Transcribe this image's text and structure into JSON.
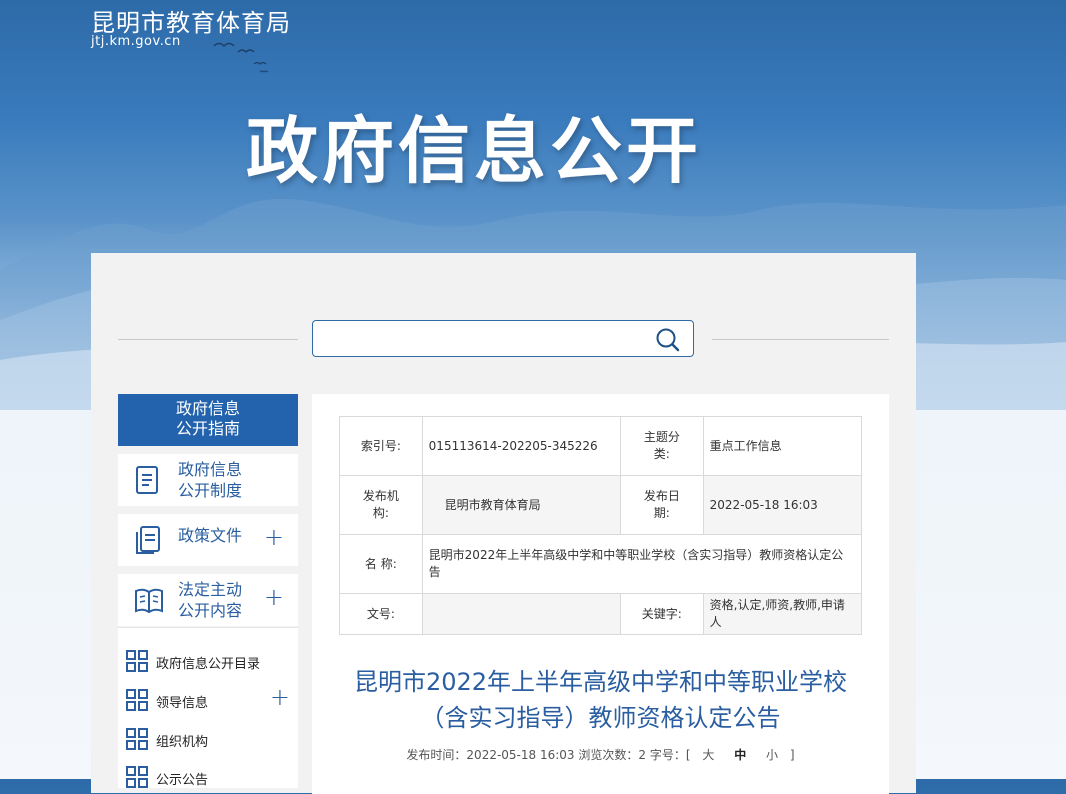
{
  "site": {
    "name": "昆明市教育体育局",
    "url": "jtj.km.gov.cn"
  },
  "banner": {
    "title": "政府信息公开"
  },
  "search": {
    "placeholder": ""
  },
  "sidebar": {
    "items": [
      {
        "label_line1": "政府信息",
        "label_line2": "公开指南"
      },
      {
        "label_line1": "政府信息",
        "label_line2": "公开制度",
        "icon": "document-icon"
      },
      {
        "label": "政策文件",
        "icon": "files-icon",
        "toggle": "+"
      },
      {
        "label_line1": "法定主动",
        "label_line2": "公开内容",
        "icon": "book-icon",
        "toggle": "+"
      }
    ],
    "sub": [
      {
        "label": "政府信息公开目录"
      },
      {
        "label": "领导信息",
        "toggle": "+"
      },
      {
        "label": "组织机构"
      },
      {
        "label": "公示公告"
      }
    ]
  },
  "meta": {
    "index_label": "索引号:",
    "index_value": "015113614-202205-345226",
    "topic_label_1": "主题分",
    "topic_label_2": "类:",
    "topic_value": "重点工作信息",
    "org_label_1": "发布机",
    "org_label_2": "构:",
    "org_value": "昆明市教育体育局",
    "date_label_1": "发布日",
    "date_label_2": "期:",
    "date_value": "2022-05-18 16:03",
    "name_label": "名 称:",
    "name_value": "昆明市2022年上半年高级中学和中等职业学校（含实习指导）教师资格认定公告",
    "docno_label": "文号:",
    "docno_value": "",
    "keywords_label": "关键字:",
    "keywords_value": "资格,认定,师资,教师,申请人"
  },
  "article": {
    "title_line1": "昆明市2022年上半年高级中学和中等职业学校",
    "title_line2": "（含实习指导）教师资格认定公告",
    "info_prefix": "发布时间：2022-05-18 16:03 浏览次数：2 字号：[",
    "size_large": "大",
    "size_medium": "中",
    "size_small": "小",
    "info_suffix": "]"
  }
}
